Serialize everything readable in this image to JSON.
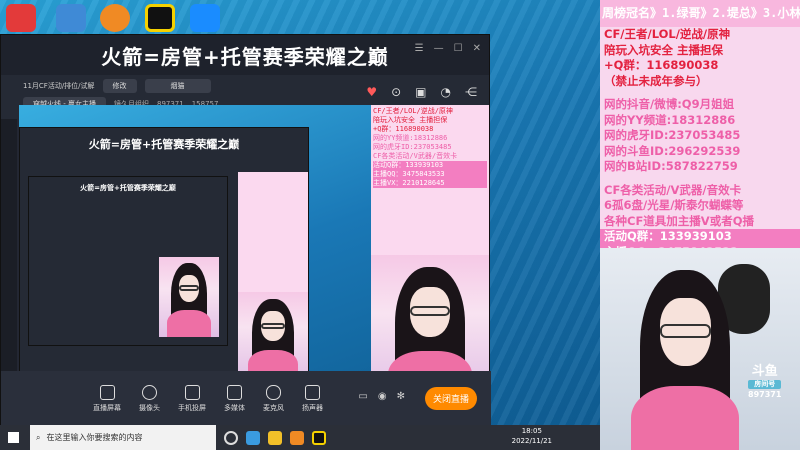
{
  "app": {
    "title": "火箭=房管+托管赛季荣耀之巅"
  },
  "header": {
    "category": "11月CF活动/排位/试解",
    "edit_label": "修改",
    "search_chip": "烟猫",
    "stream_tag": "穿越火线 - 赢女主播",
    "room_name": "镜久月组织",
    "viewer_count": "897371",
    "fans_count": "158757"
  },
  "bottom": {
    "buttons": [
      "直播屏幕",
      "摄像头",
      "手机投屏",
      "多媒体",
      "麦克风",
      "扬声器"
    ],
    "go_live": "关闭直播"
  },
  "taskbar": {
    "search_placeholder": "在这里输入你要搜索的内容",
    "time": "18:05",
    "date": "2022/11/21"
  },
  "right_panel": {
    "header": "周榜冠名》1.绿哥》2.堤总》3.小林",
    "red_lines": [
      "CF/王者/LOL/逆战/原神",
      "陪玩入坑安全 主播担保",
      "+Q群：116890038",
      "（禁止未成年参与）"
    ],
    "pink_lines": [
      "网的抖音/微博:Q9月姐姐",
      "网的YY频道:18312886",
      "网的虎牙ID:237053485",
      "网的斗鱼ID:296292539",
      "网的B站ID:587822759"
    ],
    "activity_lines": [
      "CF各类活动/V武器/音效卡",
      "6孤6盘/光星/斯泰尔蝴蝶等",
      "各种CF道具加主播V或者Q播"
    ],
    "contact_lines": [
      "活动Q群：133939103",
      "主播QQ：3475843533",
      "主播VX：2210128645"
    ]
  },
  "nested": {
    "title": "火箭=房管+托管赛季荣耀之巅"
  },
  "cam": {
    "logo": "斗鱼",
    "logo_sub": "房间号",
    "room": "897371"
  },
  "colors": {
    "pink_text": "#ee5fa8",
    "red_text": "#e3213f",
    "live_orange": "#ff8a00"
  }
}
